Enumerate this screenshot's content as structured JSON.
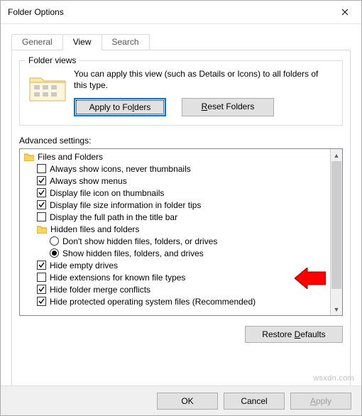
{
  "window_title": "Folder Options",
  "tabs": {
    "general": "General",
    "view": "View",
    "search": "Search"
  },
  "folder_views": {
    "title": "Folder views",
    "text": "You can apply this view (such as Details or Icons) to all folders of this type.",
    "apply_pre": "Apply to Fo",
    "apply_ul": "l",
    "apply_post": "ders",
    "reset_ul": "R",
    "reset_post": "eset Folders"
  },
  "advanced_label": "Advanced settings:",
  "tree": {
    "root": "Files and Folders",
    "items": [
      {
        "label": "Always show icons, never thumbnails",
        "checked": false
      },
      {
        "label": "Always show menus",
        "checked": true
      },
      {
        "label": "Display file icon on thumbnails",
        "checked": true
      },
      {
        "label": "Display file size information in folder tips",
        "checked": true
      },
      {
        "label": "Display the full path in the title bar",
        "checked": false
      }
    ],
    "hidden_group": "Hidden files and folders",
    "radio1": "Don't show hidden files, folders, or drives",
    "radio2": "Show hidden files, folders, and drives",
    "items2": [
      {
        "label": "Hide empty drives",
        "checked": true
      },
      {
        "label": "Hide extensions for known file types",
        "checked": false
      },
      {
        "label": "Hide folder merge conflicts",
        "checked": true
      },
      {
        "label": "Hide protected operating system files (Recommended)",
        "checked": true
      }
    ]
  },
  "restore": {
    "pre": "Restore ",
    "ul": "D",
    "post": "efaults"
  },
  "buttons": {
    "ok": "OK",
    "cancel": "Cancel",
    "apply_ul": "A",
    "apply_post": "pply"
  },
  "watermark": "wsxdn.com"
}
